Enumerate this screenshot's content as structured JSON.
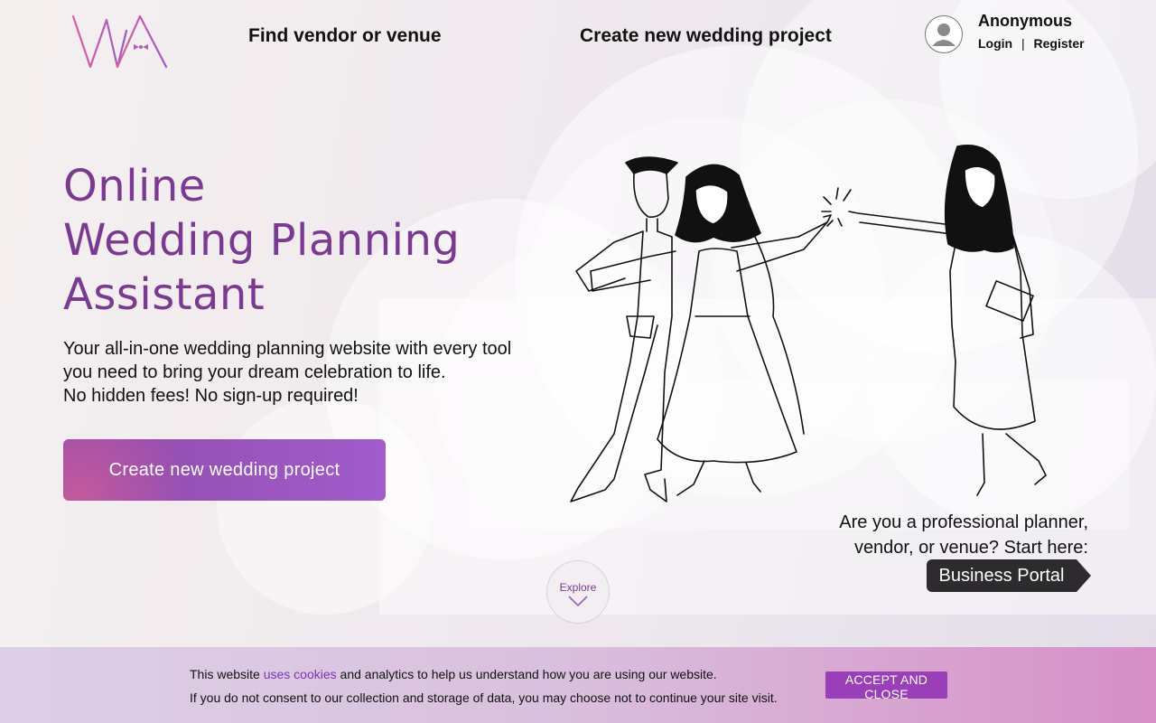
{
  "header": {
    "logo_text": "WA",
    "nav": {
      "find_vendor": "Find vendor or venue",
      "create_project": "Create new wedding project"
    },
    "user": {
      "name": "Anonymous",
      "login": "Login",
      "separator": "|",
      "register": "Register"
    }
  },
  "hero": {
    "title_lines": [
      "Online",
      "Wedding Planning",
      "Assistant"
    ],
    "subtitle_lines": [
      "Your all-in-one wedding planning website with every tool",
      "you need to bring your dream celebration to life.",
      "No hidden fees! No sign-up required!"
    ],
    "cta_label": "Create new wedding project"
  },
  "business": {
    "prompt_lines": [
      "Are you a professional planner,",
      "vendor, or venue? Start here:"
    ],
    "button_label": "Business Portal"
  },
  "explore": {
    "label": "Explore",
    "icon": "chevron-down-icon"
  },
  "cookie_banner": {
    "line1_prefix": "This website ",
    "line1_link": "uses cookies",
    "line1_suffix": " and analytics to help us understand how you are using our website.",
    "line2": "If you do not consent to our collection and storage of data, you may choose not to continue your site visit.",
    "accept_label": "ACCEPT AND CLOSE"
  },
  "colors": {
    "brand_purple": "#7b3a91",
    "cta_start": "#8f4aa8",
    "cta_end": "#a25ccc",
    "business_button": "#2d2b2e",
    "cookie_accept": "#9a3fb7",
    "cookie_link": "#7a34b0"
  }
}
